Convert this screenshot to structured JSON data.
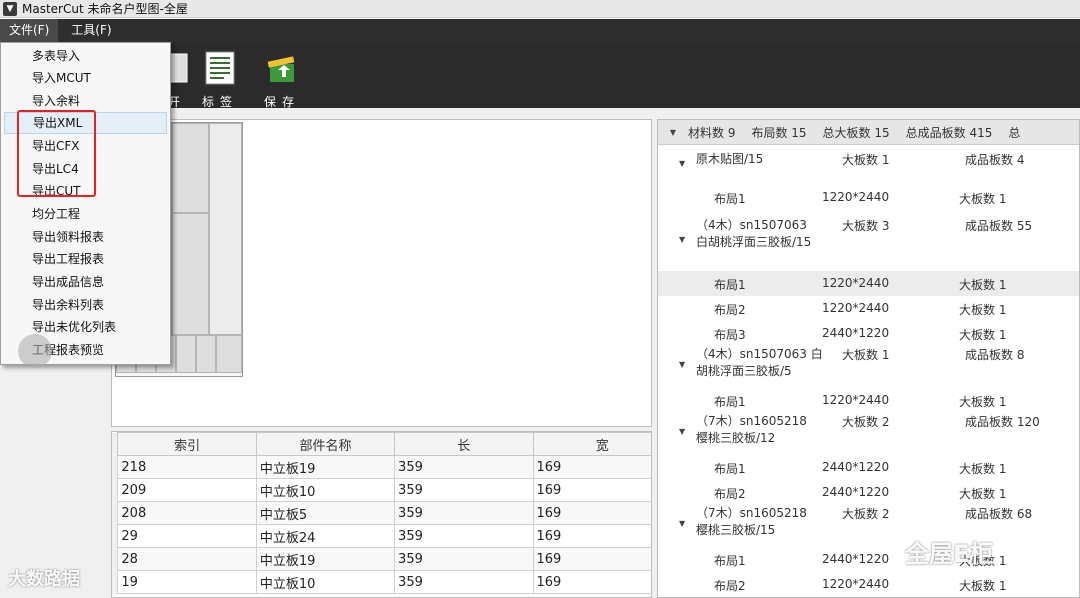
{
  "window": {
    "title": "MasterCut 未命名户型图-全屋"
  },
  "menubar": {
    "items": [
      {
        "label": "文件(F)"
      },
      {
        "label": "工具(F)"
      }
    ]
  },
  "toolbar": {
    "tools": [
      {
        "label": "开",
        "icon": "open-icon"
      },
      {
        "label": "标签",
        "icon": "label-icon"
      },
      {
        "label": "保存",
        "icon": "save-icon"
      }
    ]
  },
  "file_menu": {
    "items": [
      {
        "label": "多表导入"
      },
      {
        "label": "导入MCUT"
      },
      {
        "label": "导入余料"
      },
      {
        "label": "导出XML"
      },
      {
        "label": "导出CFX"
      },
      {
        "label": "导出LC4"
      },
      {
        "label": "导出CUT"
      },
      {
        "label": "均分工程"
      },
      {
        "label": "导出领料报表"
      },
      {
        "label": "导出工程报表"
      },
      {
        "label": "导出成品信息"
      },
      {
        "label": "导出余料列表"
      },
      {
        "label": "导出未优化列表"
      },
      {
        "label": "工程报表预览"
      }
    ],
    "highlighted": "导出XML",
    "highlight_color": "#e52222"
  },
  "parts_table": {
    "columns": [
      "索引",
      "部件名称",
      "长",
      "宽"
    ],
    "rows": [
      [
        "218",
        "中立板19",
        "359",
        "169"
      ],
      [
        "209",
        "中立板10",
        "359",
        "169"
      ],
      [
        "208",
        "中立板5",
        "359",
        "169"
      ],
      [
        "29",
        "中立板24",
        "359",
        "169"
      ],
      [
        "28",
        "中立板19",
        "359",
        "169"
      ],
      [
        "19",
        "中立板10",
        "359",
        "169"
      ]
    ]
  },
  "summary": {
    "headers": [
      "材料数 9",
      "布局数 15",
      "总大板数 15",
      "总成品板数 415",
      "总"
    ],
    "materials": [
      {
        "name": "原木贴图/15",
        "boards": "大板数 1",
        "parts": "成品板数 4",
        "layouts": [
          {
            "name": "布局1",
            "size": "1220*2440",
            "count": "大板数 1"
          }
        ]
      },
      {
        "name": "（4木）sn1507063 白胡桃浮面三胶板/15",
        "boards": "大板数 3",
        "parts": "成品板数 55",
        "layouts": [
          {
            "name": "布局1",
            "size": "1220*2440",
            "count": "大板数 1"
          },
          {
            "name": "布局2",
            "size": "1220*2440",
            "count": "大板数 1"
          },
          {
            "name": "布局3",
            "size": "2440*1220",
            "count": "大板数 1"
          }
        ]
      },
      {
        "name": "（4木）sn1507063 白胡桃浮面三胶板/5",
        "boards": "大板数 1",
        "parts": "成品板数 8",
        "layouts": [
          {
            "name": "布局1",
            "size": "1220*2440",
            "count": "大板数 1"
          }
        ]
      },
      {
        "name": "（7木）sn1605218 樱桃三胶板/12",
        "boards": "大板数 2",
        "parts": "成品板数 120",
        "layouts": [
          {
            "name": "布局1",
            "size": "2440*1220",
            "count": "大板数 1"
          },
          {
            "name": "布局2",
            "size": "2440*1220",
            "count": "大板数 1"
          }
        ]
      },
      {
        "name": "（7木）sn1605218 樱桃三胶板/15",
        "boards": "大板数 2",
        "parts": "成品板数 68",
        "layouts": [
          {
            "name": "布局1",
            "size": "2440*1220",
            "count": "大板数 1"
          },
          {
            "name": "布局2",
            "size": "1220*2440",
            "count": "大板数 1"
          }
        ]
      }
    ]
  },
  "watermarks": {
    "left": "大数路据",
    "right": "全屋E柜"
  }
}
